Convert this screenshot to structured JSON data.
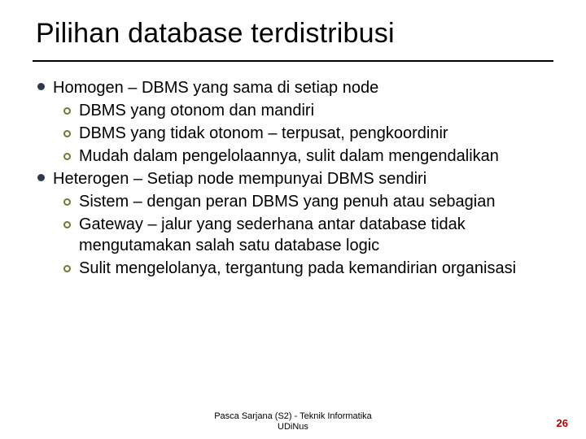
{
  "title": "Pilihan database terdistribusi",
  "footer": {
    "line1": "Pasca Sarjana (S2) - Teknik Informatika",
    "line2": "UDiNus"
  },
  "page_number": "26",
  "bullets": {
    "l1a": "Homogen – DBMS yang sama di setiap node",
    "l1a_sub1": "DBMS yang otonom dan mandiri",
    "l1a_sub2": "DBMS yang tidak otonom – terpusat, pengkoordinir",
    "l1a_sub3": "Mudah dalam pengelolaannya, sulit dalam mengendalikan",
    "l1b": "Heterogen – Setiap node mempunyai DBMS sendiri",
    "l1b_sub1": "Sistem – dengan peran DBMS yang penuh atau sebagian",
    "l1b_sub2": "Gateway – jalur yang sederhana antar database tidak mengutamakan salah satu database logic",
    "l1b_sub3": "Sulit mengelolanya, tergantung pada kemandirian organisasi"
  }
}
